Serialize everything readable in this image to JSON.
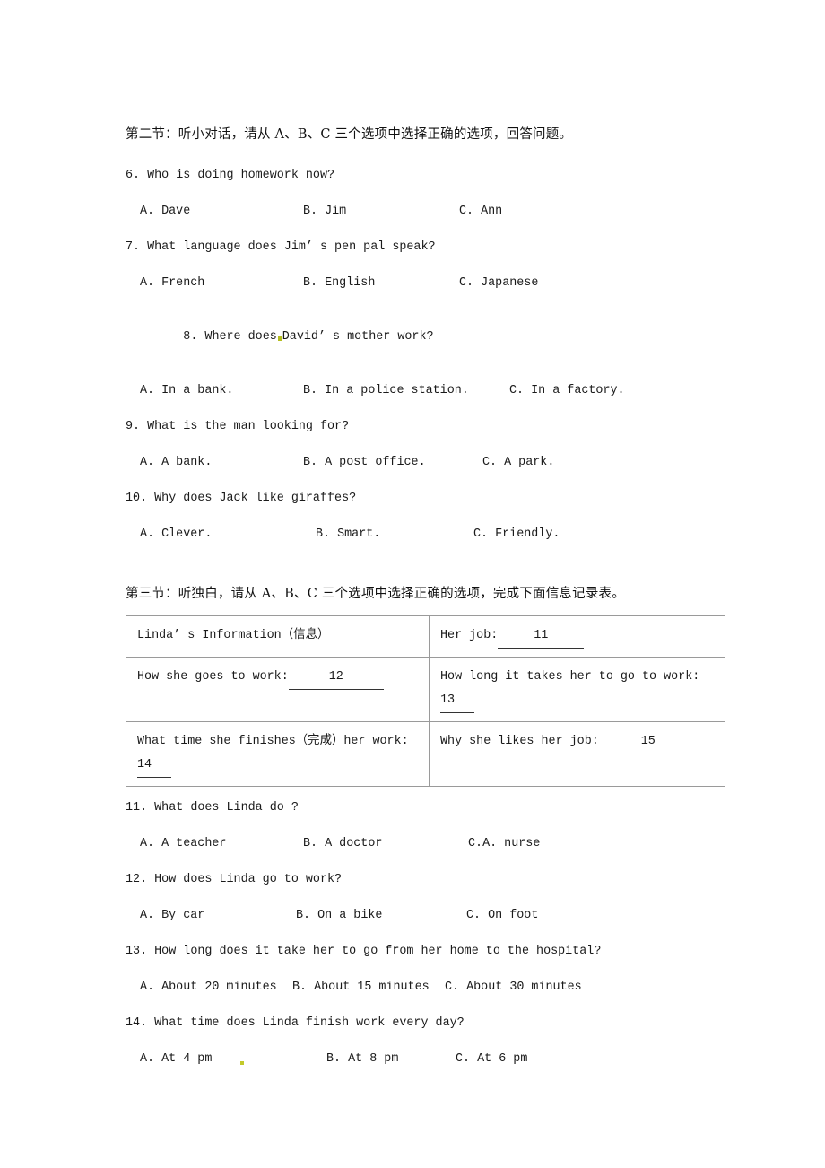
{
  "document": {
    "section2": {
      "heading": "第二节：听小对话，请从 A、B、C 三个选项中选择正确的选项，回答问题。",
      "questions": [
        {
          "stem": "6. Who is doing homework now?",
          "options": [
            "A. Dave",
            "B. Jim",
            "C. Ann"
          ]
        },
        {
          "stem": "7. What language does Jim’ s pen pal speak?",
          "options": [
            "A. French",
            "B. English",
            "C. Japanese"
          ]
        },
        {
          "stem_before": "8. Where does",
          "stem_after": "David’ s mother work?",
          "stem": "8. Where does David’ s mother work?",
          "options": [
            "A. In a bank.",
            "B. In a police station.",
            "C. In a factory."
          ]
        },
        {
          "stem": "9. What is the man looking for?",
          "options": [
            "A. A bank.",
            "B. A post office.",
            "C. A park."
          ]
        },
        {
          "stem": "10. Why does Jack like giraffes?",
          "options": [
            "A. Clever.",
            "B. Smart.",
            "C. Friendly."
          ]
        }
      ]
    },
    "section3": {
      "heading": "第三节：听独白，请从 A、B、C 三个选项中选择正确的选项，完成下面信息记录表。",
      "table": {
        "rows": [
          {
            "left": {
              "text": "Linda’ s Information（信息）",
              "blank": null
            },
            "right": {
              "label": "Her job:",
              "blank_number": "11"
            }
          },
          {
            "left": {
              "label": "How she goes to work:",
              "blank_number": "12"
            },
            "right": {
              "label": "How long it takes her to go to work:",
              "blank_number": "13"
            }
          },
          {
            "left": {
              "label": "What time she finishes（完成）her work:",
              "blank_number": "14"
            },
            "right": {
              "label": "Why she likes her job:",
              "blank_number": "15"
            }
          }
        ]
      },
      "questions": [
        {
          "stem": "11. What does Linda do ?",
          "options": [
            "A. A teacher",
            "B. A doctor",
            "C.A. nurse"
          ]
        },
        {
          "stem": "12. How does Linda go to work?",
          "options": [
            "A. By car",
            "B. On a bike",
            "C. On foot"
          ]
        },
        {
          "stem": "13. How long does it take her to go from her home to the hospital?",
          "options": [
            "A. About 20 minutes",
            "B. About 15 minutes",
            "C. About 30 minutes"
          ]
        },
        {
          "stem": "14. What time does Linda finish work every day?",
          "options": [
            "A. At 4 pm",
            "B. At 8 pm",
            "C. At 6 pm"
          ]
        }
      ]
    }
  },
  "colors": {
    "text": "#1a1a1a",
    "table_border": "#9a9a9a",
    "artifact": "#b5bd1f"
  }
}
